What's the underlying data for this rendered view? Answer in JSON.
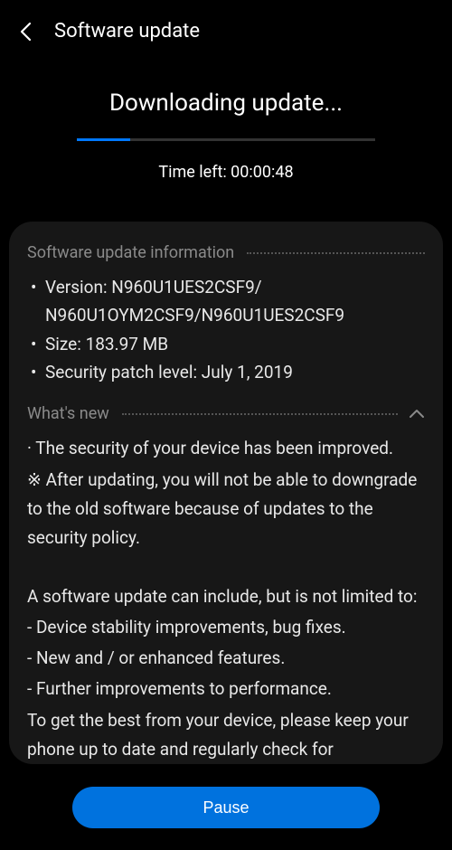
{
  "header": {
    "title": "Software update"
  },
  "download": {
    "title": "Downloading update...",
    "time_left_label": "Time left: 00:00:48",
    "progress_percent": 18
  },
  "info": {
    "section_title": "Software update information",
    "version_label": "Version: N960U1UES2CSF9/ N960U1OYM2CSF9/N960U1UES2CSF9",
    "size_label": "Size: 183.97 MB",
    "security_patch_label": "Security patch level: July 1, 2019"
  },
  "whats_new": {
    "section_title": "What's new",
    "line1": "· The security of your device has been improved.",
    "line2": "※ After updating, you will not be able to downgrade to the old software because of updates to the security policy.",
    "line3": "A software update can include, but is not limited to:",
    "item1": " - Device stability improvements, bug fixes.",
    "item2": " - New and / or enhanced features.",
    "item3": " - Further improvements to performance.",
    "line4": "To get the best from your device, please keep your phone up to date and regularly check for"
  },
  "pause_button_label": "Pause"
}
